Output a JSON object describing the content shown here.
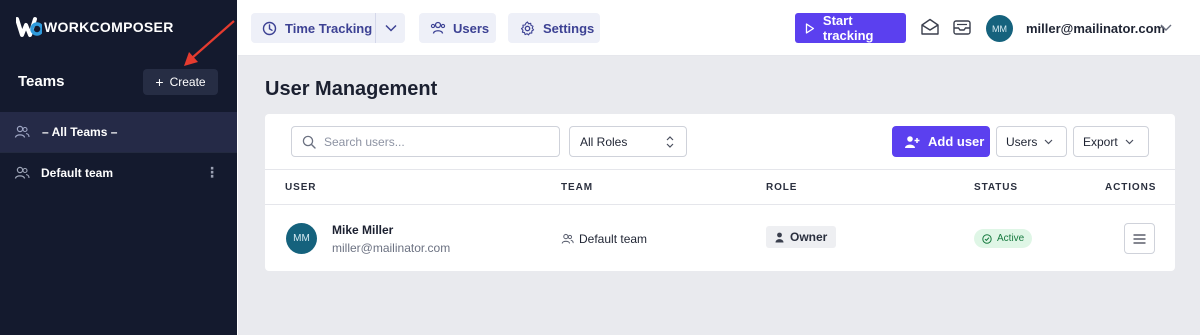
{
  "brand": {
    "logo_text": "WORKCOMPOSER",
    "accent": "#5b40ef",
    "sidebar_bg": "#141a2e"
  },
  "sidebar": {
    "title": "Teams",
    "create_label": "Create",
    "teams": [
      {
        "label": "– All Teams –",
        "active": true
      },
      {
        "label": "Default team",
        "active": false
      }
    ]
  },
  "topbar": {
    "tabs": [
      {
        "label": "Time Tracking",
        "icon": "clock-icon"
      },
      {
        "label": "Users",
        "icon": "users-icon"
      },
      {
        "label": "Settings",
        "icon": "gear-icon"
      }
    ],
    "start_tracking_label": "Start tracking",
    "user_initials": "MM",
    "user_email": "miller@mailinator.com"
  },
  "main": {
    "page_title": "User Management",
    "search_placeholder": "Search users...",
    "roles_select": "All Roles",
    "add_user_label": "Add user",
    "users_dropdown": "Users",
    "export_dropdown": "Export",
    "columns": [
      "USER",
      "TEAM",
      "ROLE",
      "STATUS",
      "ACTIONS"
    ],
    "rows": [
      {
        "initials": "MM",
        "name": "Mike Miller",
        "email": "miller@mailinator.com",
        "team": "Default team",
        "role": "Owner",
        "status": "Active"
      }
    ]
  }
}
